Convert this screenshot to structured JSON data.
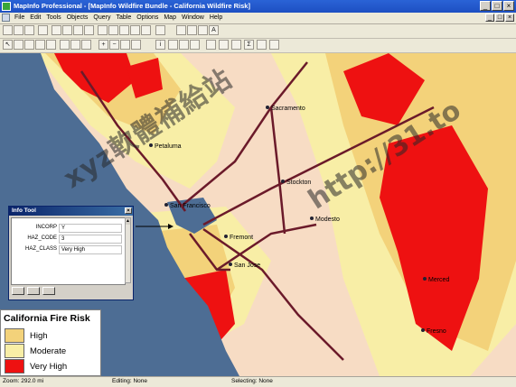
{
  "window": {
    "title": "MapInfo Professional - [MapInfo Wildfire Bundle - California Wildfire Risk]",
    "minimize": "_",
    "maximize": "□",
    "close": "×"
  },
  "menu": [
    "File",
    "Edit",
    "Tools",
    "Objects",
    "Query",
    "Table",
    "Options",
    "Map",
    "Window",
    "Help"
  ],
  "map": {
    "cities": [
      "Sacramento",
      "Petaluma",
      "Stockton",
      "San Francisco",
      "Fremont",
      "Modesto",
      "San Jose",
      "Merced",
      "Fresno"
    ],
    "colors": {
      "water": "#4d6d94",
      "low": "#f7dcc4",
      "moderate": "#f7e99a",
      "high": "#f1cf6e",
      "very_high": "#ee1111",
      "roads": "#6b1a2a"
    }
  },
  "info_tool": {
    "title": "Info Tool",
    "close": "×",
    "fields": [
      {
        "label": "INCORP",
        "value": "Y"
      },
      {
        "label": "HAZ_CODE",
        "value": "3"
      },
      {
        "label": "HAZ_CLASS",
        "value": "Very High"
      }
    ]
  },
  "legend": {
    "title": "California Fire Risk",
    "items": [
      {
        "label": "High",
        "color": "#f3d27a"
      },
      {
        "label": "Moderate",
        "color": "#f8eea6"
      },
      {
        "label": "Very High",
        "color": "#ee1111"
      }
    ]
  },
  "watermark": {
    "text1": "xyz軟體補給站",
    "text2": "http://31.to"
  },
  "status": {
    "zoom": "Zoom: 292.0 mi",
    "editing": "Editing: None",
    "selecting": "Selecting: None"
  }
}
